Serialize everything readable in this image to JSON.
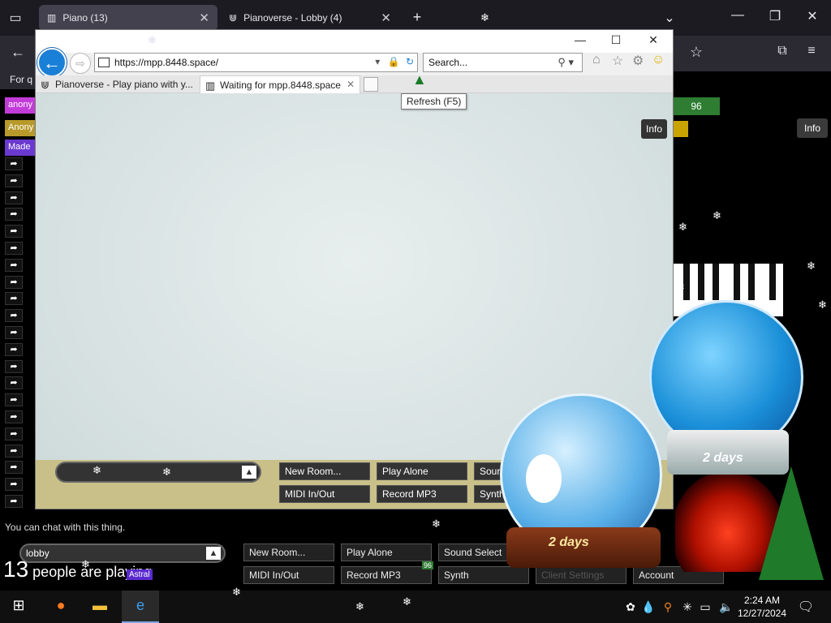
{
  "outer_browser": {
    "tabs": [
      {
        "title": "Piano (13)",
        "active": true
      },
      {
        "title": "Pianoverse - Lobby (4)",
        "active": false
      }
    ],
    "new_tab": "+",
    "bookmark_text": "For q"
  },
  "left_chat": {
    "badge1": "anony",
    "badge2": "Anony",
    "badge3": "Made",
    "arrow": "➦"
  },
  "underlying_page": {
    "green_tag": "96",
    "info_label": "Info",
    "chat_hint": "You can chat with this thing.",
    "room_select": "lobby",
    "people_count": "13",
    "people_text": "people are playing",
    "astral_badge": "Astral",
    "badge96": "96",
    "buttons": {
      "new_room": "New Room...",
      "play_alone": "Play Alone",
      "sound_select": "Sound Select",
      "midi": "MIDI In/Out",
      "record": "Record MP3",
      "synth": "Synth",
      "client_settings": "Client Settings",
      "account": "Account"
    }
  },
  "ie": {
    "address": "https://mpp.8448.space/",
    "search_placeholder": "Search...",
    "tabs": [
      {
        "title": "Pianoverse - Play piano with y...",
        "active": false
      },
      {
        "title": "Waiting for mpp.8448.space",
        "active": true
      }
    ],
    "tooltip": "Refresh (F5)",
    "info_label": "Info",
    "buttons": {
      "new_room": "New Room...",
      "play_alone": "Play Alone",
      "sound": "Sour",
      "midi": "MIDI In/Out",
      "record": "Record MP3",
      "synth": "Synth"
    }
  },
  "decor": {
    "globe_label": "2 days"
  },
  "taskbar": {
    "time": "2:24 AM",
    "date": "12/27/2024"
  }
}
